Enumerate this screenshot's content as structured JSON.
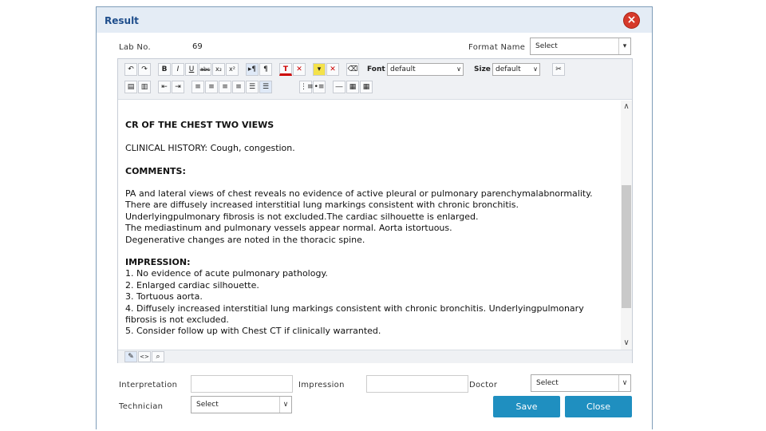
{
  "dialog": {
    "title": "Result"
  },
  "fields": {
    "lab_no_label": "Lab No.",
    "lab_no_value": "69",
    "format_name_label": "Format Name",
    "format_name_select": "Select",
    "interpretation_label": "Interpretation",
    "impression_label": "Impression",
    "doctor_label": "Doctor",
    "doctor_select": "Select",
    "technician_label": "Technician",
    "technician_select": "Select"
  },
  "toolbar": {
    "font_label": "Font",
    "font_value": "default",
    "size_label": "Size",
    "size_value": "default",
    "buttons_row1": [
      "undo-icon",
      "redo-icon",
      "bold-icon",
      "italic-icon",
      "underline-icon",
      "strikethrough-icon",
      "subscript-icon",
      "superscript-icon",
      "ltr-icon",
      "paragraph-icon",
      "text-color-icon",
      "clear-text-color-icon",
      "highlight-icon",
      "clear-highlight-icon",
      "eraser-icon"
    ],
    "buttons_row2": [
      "paste-icon",
      "paste-text-icon",
      "outdent-icon",
      "indent-icon",
      "align-left-icon",
      "align-center-icon",
      "align-right-icon",
      "align-justify-icon",
      "align-full-icon",
      "block-icon",
      "ordered-list-icon",
      "unordered-list-icon",
      "horizontal-rule-icon",
      "insert-table-icon",
      "table-properties-icon"
    ],
    "glyphs": {
      "bold": "B",
      "italic": "I",
      "underline": "U",
      "strike": "abc",
      "sub": "x₂",
      "sup": "x²",
      "text_color": "T",
      "cut": "✂"
    }
  },
  "report": {
    "heading": "CR OF THE CHEST TWO VIEWS",
    "clinical_history": "CLINICAL HISTORY: Cough, congestion.",
    "comments_heading": "COMMENTS:",
    "comments": [
      "PA and lateral views of chest reveals no evidence of active pleural or pulmonary parenchymalabnormality.",
      "There are diffusely increased interstitial lung markings consistent with chronic bronchitis.",
      "Underlyingpulmonary fibrosis is not excluded.The cardiac silhouette is enlarged.",
      "The mediastinum and pulmonary vessels appear normal. Aorta istortuous.",
      "Degenerative changes are noted in the thoracic spine."
    ],
    "impression_heading": "IMPRESSION:",
    "impressions": [
      "1. No evidence of acute pulmonary pathology.",
      "2. Enlarged cardiac silhouette.",
      "3. Tortuous aorta.",
      "4. Diffusely increased interstitial lung markings consistent with chronic bronchitis. Underlyingpulmonary",
      "fibrosis is not excluded.",
      "5. Consider follow up with Chest CT if clinically warranted."
    ]
  },
  "buttons": {
    "save": "Save",
    "close": "Close"
  },
  "colors": {
    "primary_button": "#1f8fc0",
    "title": "#1f4e8c",
    "close_icon": "#d63a2b"
  }
}
